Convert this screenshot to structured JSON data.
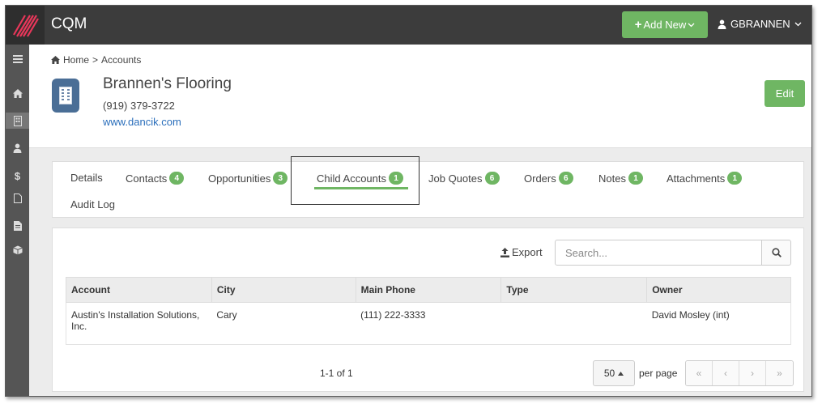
{
  "app": {
    "title": "CQM"
  },
  "topbar": {
    "add_new_label": "Add New",
    "user_label": "GBRANNEN"
  },
  "breadcrumb": {
    "home": "Home",
    "separator": ">",
    "current": "Accounts"
  },
  "account": {
    "name": "Brannen's Flooring",
    "phone": "(919) 379-3722",
    "website": "www.dancik.com",
    "edit_label": "Edit"
  },
  "tabs": [
    {
      "label": "Details",
      "count": ""
    },
    {
      "label": "Contacts",
      "count": "4"
    },
    {
      "label": "Opportunities",
      "count": "3"
    },
    {
      "label": "Child Accounts",
      "count": "1"
    },
    {
      "label": "Job Quotes",
      "count": "6"
    },
    {
      "label": "Orders",
      "count": "6"
    },
    {
      "label": "Notes",
      "count": "1"
    },
    {
      "label": "Attachments",
      "count": "1"
    },
    {
      "label": "Audit Log",
      "count": ""
    }
  ],
  "toolbar": {
    "export_label": "Export",
    "search_placeholder": "Search..."
  },
  "table": {
    "columns": [
      "Account",
      "City",
      "Main Phone",
      "Type",
      "Owner"
    ],
    "rows": [
      [
        "Austin's Installation Solutions, Inc.",
        "Cary",
        "(111) 222-3333",
        "",
        "David Mosley (int)"
      ]
    ]
  },
  "pagination": {
    "range": "1-1 of 1",
    "per_page_value": "50",
    "per_page_label": "per page",
    "first": "«",
    "prev": "‹",
    "next": "›",
    "last": "»"
  },
  "colors": {
    "accent": "#6fb663",
    "topbar": "#3c3c3c",
    "sidebar": "#555555",
    "link": "#2a6ebb",
    "icon_tile": "#4a6e96"
  },
  "icons": [
    "logo-icon",
    "plus-icon",
    "user-icon",
    "menu-icon",
    "home-icon",
    "building-icon",
    "person-icon",
    "dollar-icon",
    "document-icon",
    "file-icon",
    "cube-icon",
    "upload-icon",
    "search-icon"
  ]
}
